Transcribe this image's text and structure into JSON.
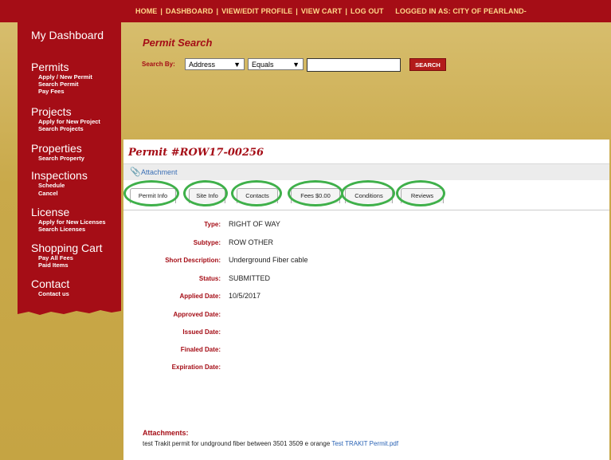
{
  "topnav": {
    "items": [
      "HOME",
      "DASHBOARD",
      "VIEW/EDIT PROFILE",
      "VIEW CART",
      "LOG OUT"
    ],
    "logged_in_label": "LOGGED IN AS:",
    "logged_in_user": "CITY OF PEARLAND-"
  },
  "sidebar": {
    "dashboard": "My Dashboard",
    "sections": [
      {
        "title": "Permits",
        "links": [
          "Apply / New Permit",
          "Search Permit",
          "Pay Fees"
        ]
      },
      {
        "title": "Projects",
        "links": [
          "Apply for New Project",
          "Search Projects"
        ]
      },
      {
        "title": "Properties",
        "links": [
          "Search Property"
        ]
      },
      {
        "title": "Inspections",
        "links": [
          "Schedule",
          "Cancel"
        ]
      },
      {
        "title": "License",
        "links": [
          "Apply for New Licenses",
          "Search Licenses"
        ]
      },
      {
        "title": "Shopping Cart",
        "links": [
          "Pay All Fees",
          "Paid Items"
        ]
      },
      {
        "title": "Contact",
        "links": [
          "Contact us"
        ]
      }
    ]
  },
  "search": {
    "title": "Permit Search",
    "search_by_label": "Search By:",
    "field_selected": "Address",
    "operator_selected": "Equals",
    "query_value": "",
    "button_label": "SEARCH"
  },
  "permit": {
    "title": "Permit #ROW17-00256",
    "attachment_link": "Attachment",
    "tabs": [
      "Permit Info",
      "Site Info",
      "Contacts",
      "Fees $0.00",
      "Conditions",
      "Reviews"
    ],
    "active_tab": "Permit Info",
    "fields": [
      {
        "label": "Type:",
        "value": "RIGHT OF WAY"
      },
      {
        "label": "Subtype:",
        "value": "ROW OTHER"
      },
      {
        "label": "Short Description:",
        "value": "Underground Fiber cable"
      },
      {
        "label": "Status:",
        "value": "SUBMITTED"
      },
      {
        "label": "Applied Date:",
        "value": "10/5/2017"
      },
      {
        "label": "Approved Date:",
        "value": ""
      },
      {
        "label": "Issued Date:",
        "value": ""
      },
      {
        "label": "Finaled Date:",
        "value": ""
      },
      {
        "label": "Expiration Date:",
        "value": ""
      }
    ],
    "attachments_heading": "Attachments:",
    "attachment_description": "test Trakit permit for undground fiber between 3501 3509 e orange",
    "attachment_file": "Test TRAKIT Permit.pdf"
  },
  "colors": {
    "brand_red": "#a50d16",
    "gold_background": "#c9a94a",
    "highlight_circle": "#3fb04a",
    "link_blue": "#2a63b5"
  }
}
